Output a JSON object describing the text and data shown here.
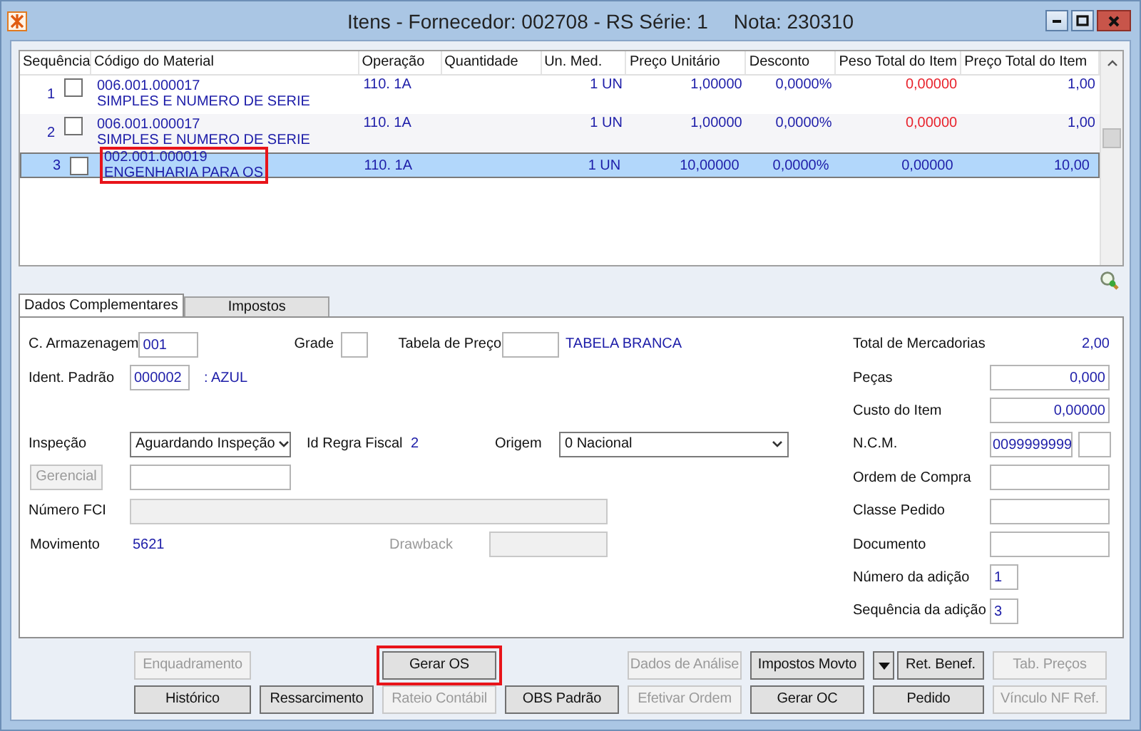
{
  "window": {
    "title": "Itens - Fornecedor: 002708 - RS Série: 1",
    "subtitle": "Nota: 230310"
  },
  "grid": {
    "columns": [
      "Sequência",
      "Código do Material",
      "Operação",
      "Quantidade",
      "Un. Med.",
      "Preço Unitário",
      "Desconto",
      "Peso Total do Item",
      "Preço Total do Item"
    ],
    "rows": [
      {
        "seq": "1",
        "checked": false,
        "selected": false,
        "highlighted": false,
        "code": "006.001.000017",
        "description": "SIMPLES E NUMERO DE SERIE",
        "operacao": "110. 1A",
        "unidade": "1 UN",
        "preco_unitario": "1,00000",
        "desconto": "0,0000%",
        "peso_total": {
          "text": "0,00000",
          "color": "#e8202a"
        },
        "preco_total": "1,00"
      },
      {
        "seq": "2",
        "checked": false,
        "selected": false,
        "highlighted": false,
        "code": "006.001.000017",
        "description": "SIMPLES E NUMERO DE SERIE",
        "operacao": "110. 1A",
        "unidade": "1 UN",
        "preco_unitario": "1,00000",
        "desconto": "0,0000%",
        "peso_total": {
          "text": "0,00000",
          "color": "#e8202a"
        },
        "preco_total": "1,00"
      },
      {
        "seq": "3",
        "checked": false,
        "selected": true,
        "highlighted": true,
        "code": "002.001.000019",
        "description": "ENGENHARIA PARA OS",
        "operacao": "110. 1A",
        "unidade": "1 UN",
        "preco_unitario": "10,00000",
        "desconto": "0,0000%",
        "peso_total": {
          "text": "0,00000",
          "color": "#1c1ca8"
        },
        "preco_total": "10,00"
      }
    ]
  },
  "tabs": [
    {
      "label": "Dados Complementares",
      "selected": true
    },
    {
      "label": "Impostos",
      "selected": false
    }
  ],
  "form": {
    "armazenagem": {
      "label": "C. Armazenagem",
      "value": "001"
    },
    "grade": {
      "label": "Grade"
    },
    "tabela_preco": {
      "label": "Tabela de Preço",
      "description": "TABELA BRANCA"
    },
    "ident_padrao": {
      "label": "Ident. Padrão",
      "value": "000002",
      "description": ": AZUL"
    },
    "inspecao": {
      "label": "Inspeção",
      "value": "Aguardando Inspeção"
    },
    "regra_fiscal": {
      "label": "Id Regra Fiscal",
      "value": "2"
    },
    "origem": {
      "label": "Origem",
      "value": "0 Nacional"
    },
    "gerencial": {
      "label": "Gerencial",
      "disabled": true
    },
    "numero_fci": {
      "label": "Número FCI",
      "disabled": true
    },
    "movimento": {
      "label": "Movimento",
      "value": "5621"
    },
    "drawback": {
      "label": "Drawback",
      "disabled": true
    },
    "total_mercadorias": {
      "label": "Total de Mercadorias",
      "value": "2,00"
    },
    "pecas": {
      "label": "Peças",
      "value": "0,000"
    },
    "custo_item": {
      "label": "Custo do Item",
      "value": "0,00000"
    },
    "ncm": {
      "label": "N.C.M.",
      "value": "0099999999"
    },
    "ordem_compra": {
      "label": "Ordem de Compra"
    },
    "classe_pedido": {
      "label": "Classe Pedido"
    },
    "documento": {
      "label": "Documento"
    },
    "numero_adicao": {
      "label": "Número da adição",
      "value": "1"
    },
    "sequencia_adicao": {
      "label": "Sequência da adição",
      "value": "3"
    }
  },
  "buttons_top": [
    {
      "label": "Enquadramento",
      "disabled": true,
      "highlighted": false,
      "kind": "button"
    },
    {
      "label": "Gerar OS",
      "disabled": false,
      "highlighted": true,
      "kind": "button"
    },
    {
      "label": "Dados de Análise",
      "disabled": true,
      "highlighted": false,
      "kind": "button"
    },
    {
      "label": "Impostos Movto",
      "disabled": false,
      "highlighted": false,
      "kind": "button"
    },
    {
      "disabled": false,
      "highlighted": false,
      "kind": "dropdown"
    },
    {
      "label": "Ret. Benef.",
      "disabled": false,
      "highlighted": false,
      "kind": "button"
    },
    {
      "label": "Tab. Preços",
      "disabled": true,
      "highlighted": false,
      "kind": "button"
    }
  ],
  "buttons_bottom": [
    {
      "label": "Histórico",
      "disabled": false
    },
    {
      "label": "Ressarcimento",
      "disabled": false
    },
    {
      "label": "Rateio Contábil",
      "disabled": true
    },
    {
      "label": "OBS Padrão",
      "disabled": false
    },
    {
      "label": "Efetivar Ordem",
      "disabled": true
    },
    {
      "label": "Gerar OC",
      "disabled": false
    },
    {
      "label": "Pedido",
      "disabled": false
    },
    {
      "label": "Vínculo NF Ref.",
      "disabled": true
    }
  ]
}
